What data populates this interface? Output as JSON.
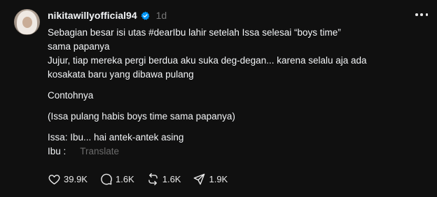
{
  "post": {
    "username": "nikitawillyofficial94",
    "time": "1d",
    "lines": [
      "Sebagian besar isi utas #dearIbu lahir setelah Issa selesai “boys time”",
      "sama papanya",
      "Jujur, tiap mereka pergi berdua aku suka deg-degan... karena selalu aja ada",
      "kosakata baru yang dibawa pulang",
      "Contohnya",
      "(Issa pulang habis boys time sama papanya)",
      "Issa: Ibu... hai antek-antek asing",
      "Ibu :"
    ],
    "translate_label": "Translate"
  },
  "actions": {
    "likes": "39.9K",
    "replies": "1.6K",
    "reposts": "1.6K",
    "shares": "1.9K"
  },
  "icons": {
    "verified": "verified-badge-icon",
    "more": "more-options-icon",
    "like": "heart-icon",
    "reply": "comment-icon",
    "repost": "repost-icon",
    "share": "share-icon"
  },
  "colors": {
    "background": "#101010",
    "verified": "#0095f6",
    "muted": "#777777"
  }
}
